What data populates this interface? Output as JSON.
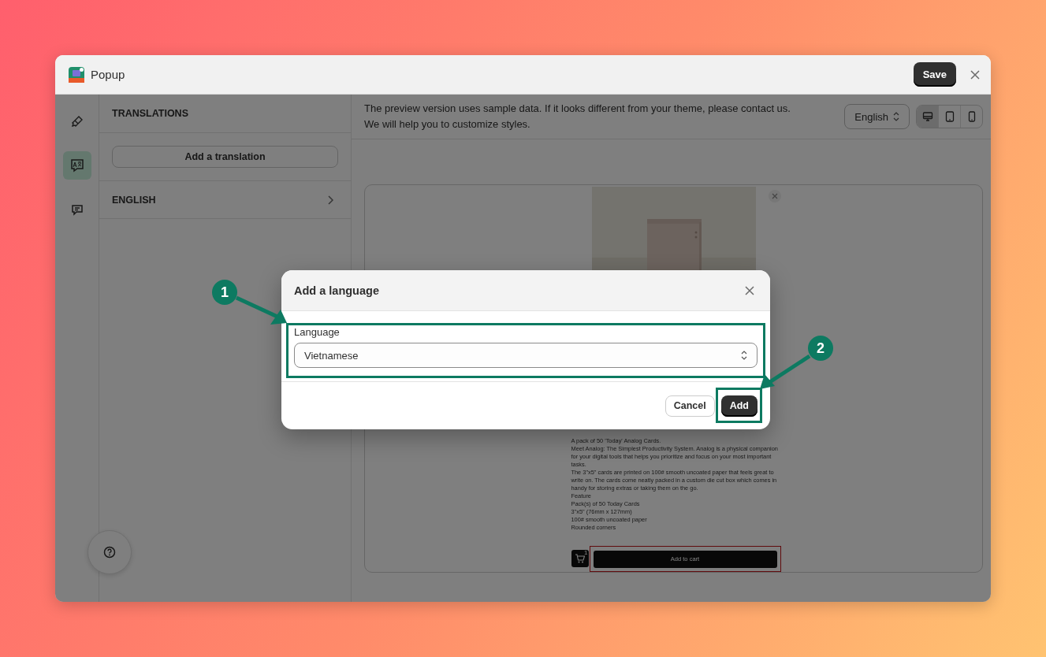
{
  "window": {
    "title": "Popup",
    "save_button": "Save"
  },
  "rail": [
    {
      "kind": "brush",
      "selected": false
    },
    {
      "kind": "translate",
      "selected": true
    },
    {
      "kind": "chat",
      "selected": false
    }
  ],
  "translations": {
    "heading": "TRANSLATIONS",
    "add_button": "Add a translation",
    "languages": [
      {
        "label": "ENGLISH"
      }
    ]
  },
  "preview": {
    "notice": [
      "The preview version uses sample data. If it looks different from your theme, please contact us.",
      "We will help you to customize styles."
    ],
    "language_select": "English",
    "devices": [
      {
        "kind": "desktop",
        "selected": true
      },
      {
        "kind": "tablet",
        "selected": false
      },
      {
        "kind": "phone",
        "selected": false
      }
    ],
    "product": {
      "description_lines": [
        "A pack of 50 'Today' Analog Cards.",
        "Meet Analog: The Simplest Productivity System. Analog is a physical companion for your digital tools that helps you prioritize and focus on your most important tasks.",
        "The 3\"x5\" cards are printed on 100# smooth uncoated paper that feels great to write on. The cards come neatly packed in a custom die cut box which comes in handy for storing extras or taking them on the go.",
        "Feature",
        "Pack(s) of 50 Today Cards",
        "3\"x5\" (76mm x 127mm)",
        "100# smooth uncoated paper",
        "Rounded corners"
      ],
      "cart_count": "1",
      "add_to_cart": "Add to cart"
    }
  },
  "dialog": {
    "title": "Add a language",
    "field_label": "Language",
    "value": "Vietnamese",
    "cancel": "Cancel",
    "add": "Add"
  },
  "annotations": [
    {
      "label": "1"
    },
    {
      "label": "2"
    }
  ]
}
